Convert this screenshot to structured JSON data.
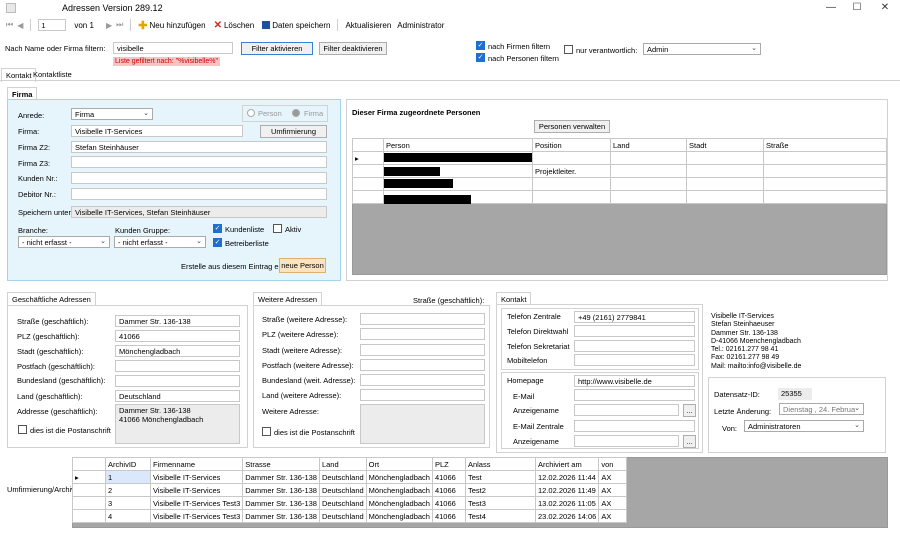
{
  "window": {
    "title": "Adressen Version 289.12",
    "min": "—",
    "max": "☐",
    "close": "✕"
  },
  "toolbar": {
    "record": "1",
    "of": "von 1",
    "add": "Neu hinzufügen",
    "delete": "Löschen",
    "save": "Daten speichern",
    "refresh": "Aktualisieren",
    "user": "Administrator"
  },
  "filter": {
    "label": "Nach Name oder Firma filtern:",
    "value": "visibelle",
    "hint": "Liste gefiltert nach: \"%visibelle%\"",
    "activate": "Filter aktivieren",
    "deactivate": "Filter deaktivieren",
    "by_company": "nach Firmen filtern",
    "by_person": "nach Personen filtern",
    "only_resp": "nur verantwortlich:",
    "resp_value": "Admin"
  },
  "tabs": [
    "Kontakt",
    "Kontaktliste"
  ],
  "firma": {
    "tab": "Firma",
    "anrede_label": "Anrede:",
    "anrede": "Firma",
    "opt_person": "Person",
    "opt_firma": "Firma",
    "firma_label": "Firma:",
    "firma": "Visibelle IT-Services",
    "umfirmierung": "Umfirmierung",
    "z2_label": "Firma Z2:",
    "z2": "Stefan Steinhäuser",
    "z3_label": "Firma Z3:",
    "kunden_label": "Kunden Nr.:",
    "debitor_label": "Debitor Nr.:",
    "speichern_label": "Speichern unter:",
    "speichern": "Visibelle IT-Services, Stefan Steinhäuser",
    "branche_label": "Branche:",
    "branche": "- nicht erfasst -",
    "gruppe_label": "Kunden Gruppe:",
    "gruppe": "- nicht erfasst -",
    "kundenliste": "Kundenliste",
    "aktiv": "Aktiv",
    "betreiberliste": "Betreiberliste",
    "erstelle": "Erstelle aus diesem Eintrag eine",
    "neue_person": "neue Person"
  },
  "persons": {
    "title": "Dieser Firma zugeordnete Personen",
    "manage": "Personen verwalten",
    "columns": [
      "Person",
      "Position",
      "Land",
      "Stadt",
      "Straße"
    ],
    "rows": [
      {
        "position": ""
      },
      {
        "position": "Projektleiter."
      },
      {
        "position": ""
      },
      {
        "position": ""
      }
    ]
  },
  "geschaeft": {
    "tab": "Geschäftliche Adressen",
    "strasse_label": "Straße (geschäftlich):",
    "strasse": "Dammer Str. 136-138",
    "plz_label": "PLZ (geschäftlich):",
    "plz": "41066",
    "stadt_label": "Stadt (geschäftlich):",
    "stadt": "Mönchengladbach",
    "postfach_label": "Postfach (geschäftlich):",
    "bundesland_label": "Bundesland (geschäftlich):",
    "land_label": "Land (geschäftlich):",
    "land": "Deutschland",
    "adresse_label": "Addresse (geschäftlich):",
    "adresse1": "Dammer Str. 136-138",
    "adresse2": "41066 Mönchengladbach",
    "post": "dies ist die Postanschrift"
  },
  "weitere": {
    "tab": "Weitere Adressen",
    "heading": "Straße (geschäftlich):",
    "strasse_label": "Straße (weitere Adresse):",
    "plz_label": "PLZ (weitere Adresse):",
    "stadt_label": "Stadt (weitere Adresse):",
    "postfach_label": "Postfach (weitere Adresse):",
    "bundesland_label": "Bundesland (weit. Adresse):",
    "land_label": "Land (weitere Adresse):",
    "adresse_label": "Weitere Adresse:",
    "post": "dies ist die Postanschrift"
  },
  "kontakt": {
    "tab": "Kontakt",
    "tel_zentrale_label": "Telefon Zentrale",
    "tel_zentrale": "+49 (2161) 2779841",
    "tel_direkt_label": "Telefon Direktwahl",
    "tel_sekr_label": "Telefon Sekretariat",
    "mobil_label": "Mobiltelefon",
    "homepage_label": "Homepage",
    "homepage": "http://www.visibelle.de",
    "email_label": "E-Mail",
    "anzeige_label": "Anzeigename",
    "email2_label": "E-Mail Zentrale",
    "anzeige2_label": "Anzeigename",
    "dots": "..."
  },
  "card": [
    "Visibelle IT-Services",
    "Stefan Steinhaeuser",
    "Dammer Str. 136-138",
    "D-41066 Moenchengladbach",
    "Tel.: 02161.277 98 41",
    "Fax: 02161.277 98 49",
    "Mail: mailto:info@visibelle.de"
  ],
  "meta": {
    "id_label": "Datensatz-ID:",
    "id": "25355",
    "change_label": "Letzte Änderung:",
    "date": "Dienstag , 24. Februa",
    "von_label": "Von:",
    "von": "Administratoren"
  },
  "archiv": {
    "label": "Umfirmierung/Archiv",
    "columns": [
      "ArchivID",
      "Firmenname",
      "Strasse",
      "Land",
      "Ort",
      "PLZ",
      "Anlass",
      "Archiviert am",
      "von"
    ],
    "rows": [
      [
        "1",
        "Visibelle IT-Services",
        "Dammer Str. 136-138",
        "Deutschland",
        "Mönchengladbach",
        "41066",
        "Test",
        "12.02.2026 11:44",
        "AX"
      ],
      [
        "2",
        "Visibelle IT-Services",
        "Dammer Str. 136-138",
        "Deutschland",
        "Mönchengladbach",
        "41066",
        "Test2",
        "12.02.2026 11:49",
        "AX"
      ],
      [
        "3",
        "Visibelle IT-Services Test3",
        "Dammer Str. 136-138",
        "Deutschland",
        "Mönchengladbach",
        "41066",
        "Test3",
        "13.02.2026 11:05",
        "AX"
      ],
      [
        "4",
        "Visibelle IT-Services Test3",
        "Dammer Str. 136-138",
        "Deutschland",
        "Mönchengladbach",
        "41066",
        "Test4",
        "23.02.2026 14:06",
        "AX"
      ]
    ]
  }
}
